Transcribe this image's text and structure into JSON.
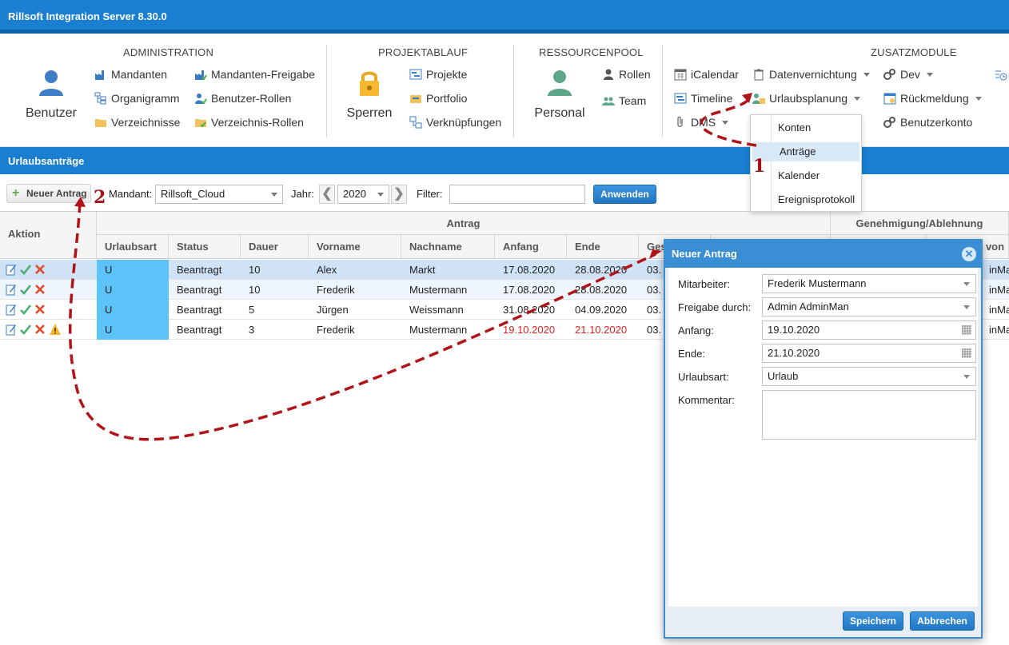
{
  "app": {
    "title": "Rillsoft Integration Server 8.30.0"
  },
  "ribbon": {
    "administration": {
      "title": "ADMINISTRATION",
      "big": "Benutzer",
      "items": [
        "Mandanten",
        "Organigramm",
        "Verzeichnisse",
        "Mandanten-Freigabe",
        "Benutzer-Rollen",
        "Verzeichnis-Rollen"
      ]
    },
    "projektablauf": {
      "title": "PROJEKTABLAUF",
      "big": "Sperren",
      "items": [
        "Projekte",
        "Portfolio",
        "Verknüpfungen"
      ]
    },
    "ressourcenpool": {
      "title": "RESSOURCENPOOL",
      "big": "Personal",
      "items": [
        "Rollen",
        "Team"
      ]
    },
    "zusatzmodule": {
      "title": "ZUSATZMODULE",
      "items": [
        "iCalendar",
        "Timeline",
        "DMS",
        "Datenvernichtung",
        "Urlaubsplanung",
        "Dev",
        "Rückmeldung",
        "Benutzerkonto"
      ]
    },
    "urlaubsplanung_menu": [
      "Konten",
      "Anträge",
      "Kalender",
      "Ereignisprotokoll"
    ],
    "urlaubsplanung_selected": "Anträge"
  },
  "panel": {
    "title": "Urlaubsanträge"
  },
  "toolbar": {
    "new_label": "Neuer Antrag",
    "mandant_label": "Mandant:",
    "mandant_value": "Rillsoft_Cloud",
    "jahr_label": "Jahr:",
    "jahr_value": "2020",
    "filter_label": "Filter:",
    "filter_value": "",
    "apply_label": "Anwenden"
  },
  "grid": {
    "group_action": "Aktion",
    "group_antrag": "Antrag",
    "group_genehmigung": "Genehmigung/Ablehnung",
    "columns": [
      "Urlaubsart",
      "Status",
      "Dauer",
      "Vorname",
      "Nachname",
      "Anfang",
      "Ende",
      "Ges",
      "",
      "",
      "t von"
    ],
    "rows": [
      {
        "art": "U",
        "status": "Beantragt",
        "dauer": "10",
        "vorname": "Alex",
        "nachname": "Markt",
        "anfang": "17.08.2020",
        "ende": "28.08.2020",
        "ges": "03.",
        "right": "inMa",
        "warn": false,
        "red": false
      },
      {
        "art": "U",
        "status": "Beantragt",
        "dauer": "10",
        "vorname": "Frederik",
        "nachname": "Mustermann",
        "anfang": "17.08.2020",
        "ende": "28.08.2020",
        "ges": "03.",
        "right": "inMa",
        "warn": false,
        "red": false
      },
      {
        "art": "U",
        "status": "Beantragt",
        "dauer": "5",
        "vorname": "Jürgen",
        "nachname": "Weissmann",
        "anfang": "31.08.2020",
        "ende": "04.09.2020",
        "ges": "03.",
        "right": "inMa",
        "warn": false,
        "red": false
      },
      {
        "art": "U",
        "status": "Beantragt",
        "dauer": "3",
        "vorname": "Frederik",
        "nachname": "Mustermann",
        "anfang": "19.10.2020",
        "ende": "21.10.2020",
        "ges": "03.",
        "right": "inMa",
        "warn": true,
        "red": true
      }
    ]
  },
  "dialog": {
    "title": "Neuer Antrag",
    "fields": {
      "mitarbeiter_label": "Mitarbeiter:",
      "mitarbeiter_value": "Frederik Mustermann",
      "freigabe_label": "Freigabe durch:",
      "freigabe_value": "Admin AdminMan",
      "anfang_label": "Anfang:",
      "anfang_value": "19.10.2020",
      "ende_label": "Ende:",
      "ende_value": "21.10.2020",
      "urlaubsart_label": "Urlaubsart:",
      "urlaubsart_value": "Urlaub",
      "kommentar_label": "Kommentar:",
      "kommentar_value": ""
    },
    "save_label": "Speichern",
    "cancel_label": "Abbrechen"
  },
  "annotations": {
    "step1": "1",
    "step2": "2"
  },
  "colors": {
    "accent": "#1a7fd0",
    "urlaubsart": "#5cc3f8",
    "warning_date": "#e02020",
    "annotation": "#a01418"
  }
}
